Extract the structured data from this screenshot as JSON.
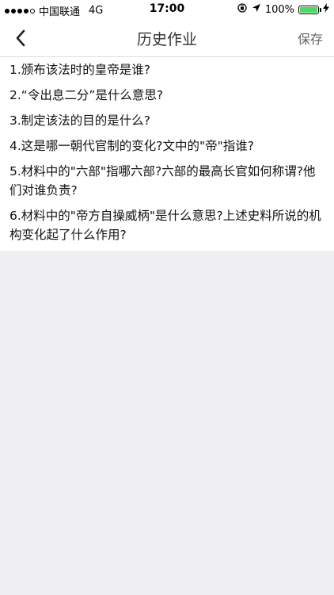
{
  "status_bar": {
    "carrier": "中国联通",
    "network": "4G",
    "time": "17:00",
    "battery_text": "100%",
    "battery_level": 1.0
  },
  "nav": {
    "title": "历史作业",
    "save_label": "保存"
  },
  "questions": [
    "1.颁布该法时的皇帝是谁?",
    "2.“令出息二分”是什么意思?",
    "3.制定该法的目的是什么?",
    "4.这是哪一朝代官制的变化?文中的\"帝\"指谁?",
    "5.材料中的\"六部\"指哪六部?六部的最高长官如何称谓?他们对谁负责?",
    "6.材料中的\"帝方自操威柄\"是什么意思?上述史料所说的机构变化起了什么作用?"
  ],
  "colors": {
    "battery": "#4cd964",
    "background": "#efeff4"
  }
}
